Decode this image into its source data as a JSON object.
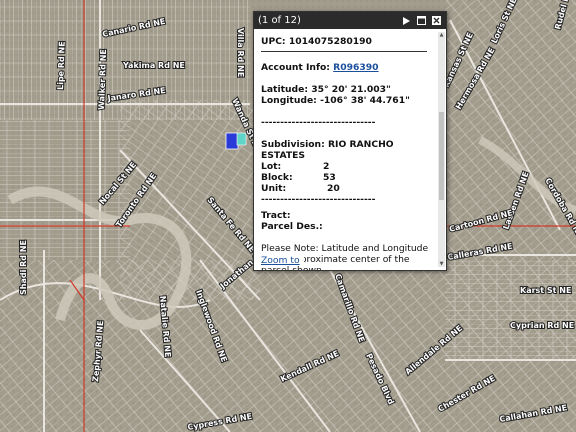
{
  "map": {
    "street_labels": [
      {
        "text": "Canario Rd NE"
      },
      {
        "text": "Yakima Rd NE"
      },
      {
        "text": "Janaro Rd NE"
      },
      {
        "text": "Lipe Rd NE"
      },
      {
        "text": "Walker Rd NE"
      },
      {
        "text": "Villa Rd NE"
      },
      {
        "text": "Wanda St NE"
      },
      {
        "text": "Toronto Rd NE"
      },
      {
        "text": "Nocal St NE"
      },
      {
        "text": "Santa Fe Rd NE"
      },
      {
        "text": "Jonathan St NE"
      },
      {
        "text": "Inglewood Rd NE"
      },
      {
        "text": "Natalie Rd NE"
      },
      {
        "text": "Zephyr Rd NE"
      },
      {
        "text": "Kendall Rd NE"
      },
      {
        "text": "Shadi Rd NE"
      },
      {
        "text": "Camarillo Rd NE"
      },
      {
        "text": "Allendale Rd NE"
      },
      {
        "text": "Pesado Blvd"
      },
      {
        "text": "Chester Rd NE"
      },
      {
        "text": "Cypress Rd NE"
      },
      {
        "text": "Kansas St NE"
      },
      {
        "text": "Lassen Rd NE"
      },
      {
        "text": "Cartoon Rd NE"
      },
      {
        "text": "Calleras Rd NE"
      },
      {
        "text": "Karst St NE"
      },
      {
        "text": "Cyprian Rd NE"
      },
      {
        "text": "Callahan Rd NE"
      },
      {
        "text": "Hermosa Rd NE"
      },
      {
        "text": "Loris St NE"
      },
      {
        "text": "Rudel Rd NE"
      },
      {
        "text": "Cordoba Rd NE"
      }
    ],
    "highlight_color": "#2a3ad6",
    "selection_color": "#5fd4c8"
  },
  "popup": {
    "counter": "(1 of 12)",
    "upc_label": "UPC:",
    "upc_value": "1014075280190",
    "account_label": "Account Info:",
    "account_value": "R096390",
    "latitude_label": "Latitude:",
    "latitude_value": "35° 20' 21.003\"",
    "longitude_label": "Longitude:",
    "longitude_value": "-106° 38' 44.761\"",
    "separator": "------------------------------",
    "subdivision_label": "Subdivision:",
    "subdivision_value": "RIO RANCHO ESTATES",
    "lot_label": "Lot:",
    "lot_value": "2",
    "block_label": "Block:",
    "block_value": "53",
    "unit_label": "Unit:",
    "unit_value": "20",
    "tract_label": "Tract:",
    "parcel_label": "Parcel Des.:",
    "note": "Please Note: Latitude and Longitude is the approximate center of the parcel shown.",
    "zoom_link": "Zoom to"
  }
}
